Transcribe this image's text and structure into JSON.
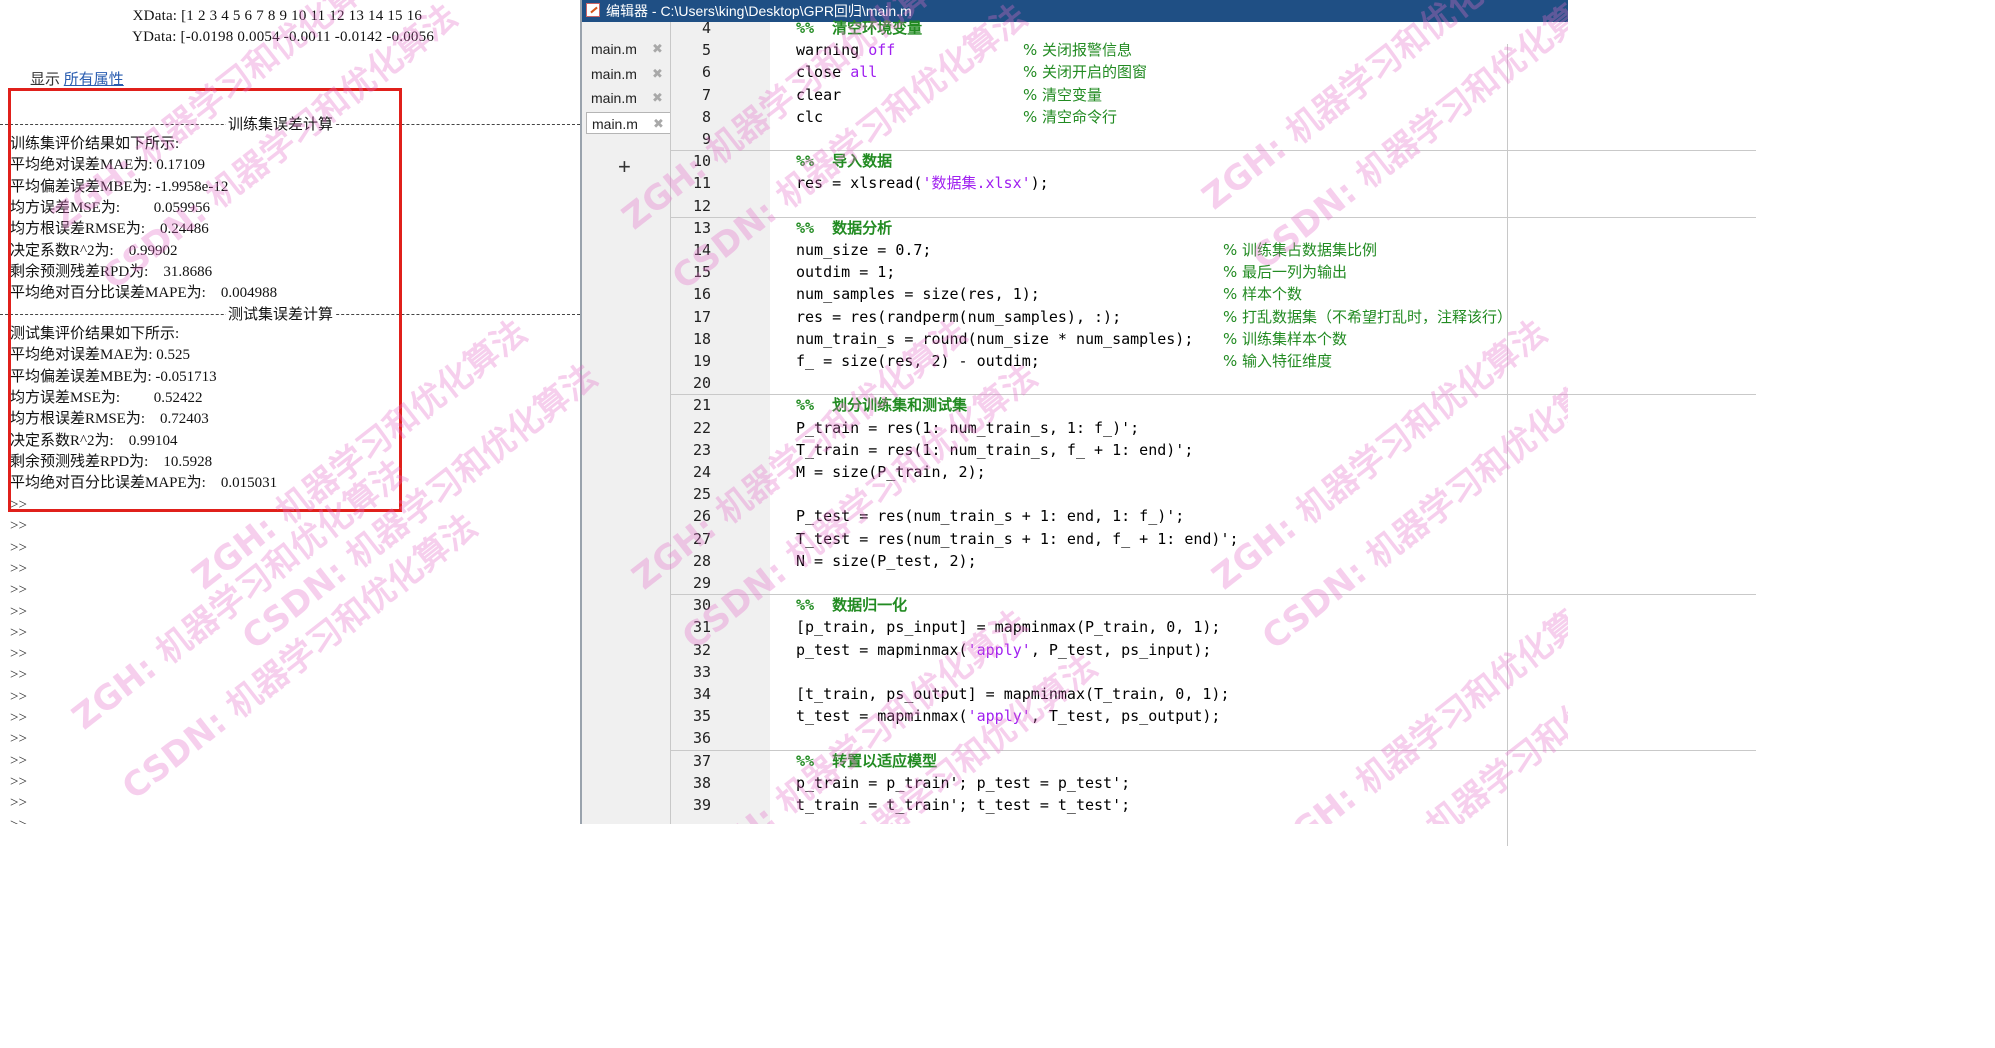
{
  "command_window": {
    "top_lines": [
      "  XData: [1 2 3 4 5 6 7 8 9 10 11 12 13 14 15 16",
      "  YData: [-0.0198 0.0054 -0.0011 -0.0142 -0.0056"
    ],
    "show_label": "显示",
    "show_link": "所有属性",
    "train_header": "训练集误差计算",
    "train_lines": [
      "训练集评价结果如下所示:",
      "平均绝对误差MAE为: 0.17109",
      "平均偏差误差MBE为: -1.9958e-12",
      "均方误差MSE为:         0.059956",
      "均方根误差RMSE为:    0.24486",
      "决定系数R^2为:    0.99902",
      "剩余预测残差RPD为:    31.8686",
      "平均绝对百分比误差MAPE为:    0.004988"
    ],
    "test_header": "测试集误差计算",
    "test_lines": [
      "测试集评价结果如下所示:",
      "平均绝对误差MAE为: 0.525",
      "平均偏差误差MBE为: -0.051713",
      "均方误差MSE为:         0.52422",
      "均方根误差RMSE为:    0.72403",
      "决定系数R^2为:    0.99104",
      "剩余预测残差RPD为:    10.5928",
      "平均绝对百分比误差MAPE为:    0.015031"
    ],
    "prompts": [
      ">>",
      ">>",
      ">>",
      ">>",
      ">>",
      ">>",
      ">>",
      ">>",
      ">>",
      ">>",
      ">>",
      ">>",
      ">>",
      ">>",
      ">>",
      ">>"
    ]
  },
  "editor": {
    "title": "编辑器 - C:\\Users\\king\\Desktop\\GPR回归\\main.m",
    "tabs": [
      "main.m",
      "main.m",
      "main.m",
      "main.m"
    ],
    "active_tab": 3,
    "new_tab": "+",
    "lines": [
      {
        "n": "4",
        "code": "",
        "sec": "%%  清空环境变量",
        "comment": ""
      },
      {
        "n": "5",
        "code": "warning ",
        "kw": "off",
        "comment": "% 关闭报警信息"
      },
      {
        "n": "6",
        "code": "close ",
        "kw": "all",
        "comment": "% 关闭开启的图窗"
      },
      {
        "n": "7",
        "code": "clear",
        "comment": "% 清空变量"
      },
      {
        "n": "8",
        "code": "clc",
        "comment": "% 清空命令行"
      },
      {
        "n": "9",
        "code": ""
      },
      {
        "n": "10",
        "code": "",
        "sec": "%%  导入数据",
        "rule": true
      },
      {
        "n": "11",
        "code": "res = xlsread(",
        "str": "'数据集.xlsx'",
        "tail": ");"
      },
      {
        "n": "12",
        "code": ""
      },
      {
        "n": "13",
        "code": "",
        "sec": "%%  数据分析",
        "rule": true
      },
      {
        "n": "14",
        "code": "num_size = 0.7;",
        "comment2": "% 训练集占数据集比例"
      },
      {
        "n": "15",
        "code": "outdim = 1;",
        "comment2": "% 最后一列为输出"
      },
      {
        "n": "16",
        "code": "num_samples = size(res, 1);",
        "comment2": "% 样本个数"
      },
      {
        "n": "17",
        "code": "res = res(randperm(num_samples), :);",
        "comment2": "% 打乱数据集（不希望打乱时，注释该行）"
      },
      {
        "n": "18",
        "code": "num_train_s = round(num_size * num_samples);",
        "comment2": "% 训练集样本个数"
      },
      {
        "n": "19",
        "code": "f_ = size(res, 2) - outdim;",
        "comment2": "% 输入特征维度"
      },
      {
        "n": "20",
        "code": ""
      },
      {
        "n": "21",
        "code": "",
        "sec": "%%  划分训练集和测试集",
        "rule": true
      },
      {
        "n": "22",
        "code": "P_train = res(1: num_train_s, 1: f_)';"
      },
      {
        "n": "23",
        "code": "T_train = res(1: num_train_s, f_ + 1: end)';"
      },
      {
        "n": "24",
        "code": "M = size(P_train, 2);"
      },
      {
        "n": "25",
        "code": ""
      },
      {
        "n": "26",
        "code": "P_test = res(num_train_s + 1: end, 1: f_)';"
      },
      {
        "n": "27",
        "code": "T_test = res(num_train_s + 1: end, f_ + 1: end)';"
      },
      {
        "n": "28",
        "code": "N = size(P_test, 2);"
      },
      {
        "n": "29",
        "code": ""
      },
      {
        "n": "30",
        "code": "",
        "sec": "%%  数据归一化",
        "rule": true
      },
      {
        "n": "31",
        "code": "[p_train, ps_input] = mapminmax(P_train, 0, 1);"
      },
      {
        "n": "32",
        "code": "p_test = mapminmax(",
        "str": "'apply'",
        "tail": ", P_test, ps_input);"
      },
      {
        "n": "33",
        "code": ""
      },
      {
        "n": "34",
        "code": "[t_train, ps_output] = mapminmax(T_train, 0, 1);"
      },
      {
        "n": "35",
        "code": "t_test = mapminmax(",
        "str": "'apply'",
        "tail": ", T_test, ps_output);"
      },
      {
        "n": "36",
        "code": ""
      },
      {
        "n": "37",
        "code": "",
        "sec": "%%  转置以适应模型",
        "rule": true
      },
      {
        "n": "38",
        "code": "p_train = p_train'; p_test = p_test';"
      },
      {
        "n": "39",
        "code": "t_train = t_train'; t_test = t_test';"
      }
    ]
  },
  "watermark": {
    "line1": "ZGH: 机器学习和优化算法",
    "line2": "CSDN: 机器学习和优化算法"
  }
}
